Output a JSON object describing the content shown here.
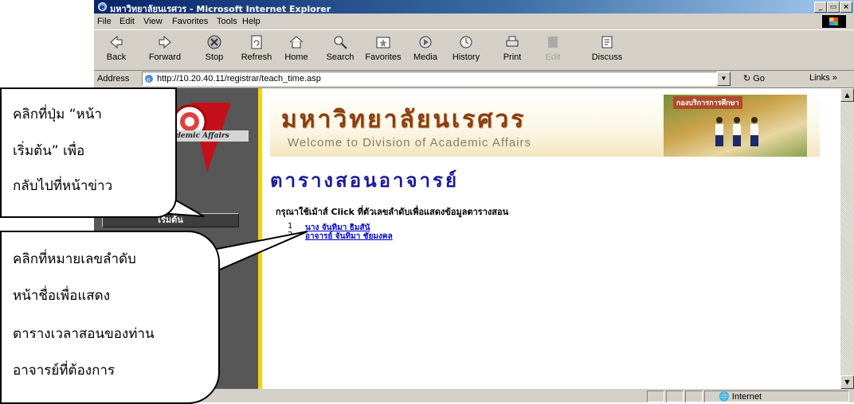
{
  "window": {
    "title": "มหาวิทยาลัยนเรศวร - Microsoft Internet Explorer",
    "controls": [
      "_",
      "▭",
      "×"
    ]
  },
  "menu": [
    "File",
    "Edit",
    "View",
    "Favorites",
    "Tools",
    "Help"
  ],
  "toolbar": {
    "buttons": [
      {
        "label": "Back",
        "icon": "back-arrow-icon"
      },
      {
        "label": "Forward",
        "icon": "forward-arrow-icon"
      },
      {
        "label": "Stop",
        "icon": "stop-icon"
      },
      {
        "label": "Refresh",
        "icon": "refresh-icon"
      },
      {
        "label": "Home",
        "icon": "home-icon"
      },
      {
        "label": "Search",
        "icon": "search-icon"
      },
      {
        "label": "Favorites",
        "icon": "favorites-icon"
      },
      {
        "label": "Media",
        "icon": "media-icon"
      },
      {
        "label": "History",
        "icon": "history-icon"
      },
      {
        "label": "Print",
        "icon": "print-icon"
      },
      {
        "label": "Edit",
        "icon": "edit-icon"
      },
      {
        "label": "Discuss",
        "icon": "discuss-icon"
      }
    ]
  },
  "address": {
    "label": "Address",
    "url": "http://10.20.40.11/registrar/teach_time.asp",
    "go": "Go",
    "links": "Links »"
  },
  "sidebar": {
    "academic_label": "Academic Affairs",
    "home_button": "เริ่มต้น"
  },
  "banner": {
    "university": "มหาวิทยาลัยนเรศวร",
    "welcome": "Welcome to Division of Academic Affairs",
    "photo_caption": "กองบริการการศึกษา"
  },
  "page": {
    "title": "ตารางสอนอาจารย์",
    "instruction": "กรุณาใช้เม้าส์ Click ที่ตัวเลขลำดับเพื่อแสดงข้อมูลตารางสอน",
    "teachers": [
      {
        "num": "1",
        "name": "นาง จันทิมา ธิมสันั"
      },
      {
        "num": "2",
        "name": "อาจารย์ จันทิมา ชัยมงคล"
      }
    ]
  },
  "status": {
    "zone": "Internet"
  },
  "callouts": {
    "top": [
      "คลิกที่ปุ่ม “หน้า",
      "เริ่มต้น” เพื่อ",
      "กลับไปที่หน้าข่าว"
    ],
    "bottom": [
      "คลิกที่หมายเลขลำดับ",
      "หน้าชื่อเพื่อแสดง",
      "ตารางเวลาสอนของท่าน",
      "อาจารย์ที่ต้องการ"
    ]
  },
  "colors": {
    "title_blue": "#0a246a",
    "accent_yellow": "#f4d20a",
    "heading_blue": "#1a1a9a",
    "banner_brown": "#8a3c10"
  }
}
